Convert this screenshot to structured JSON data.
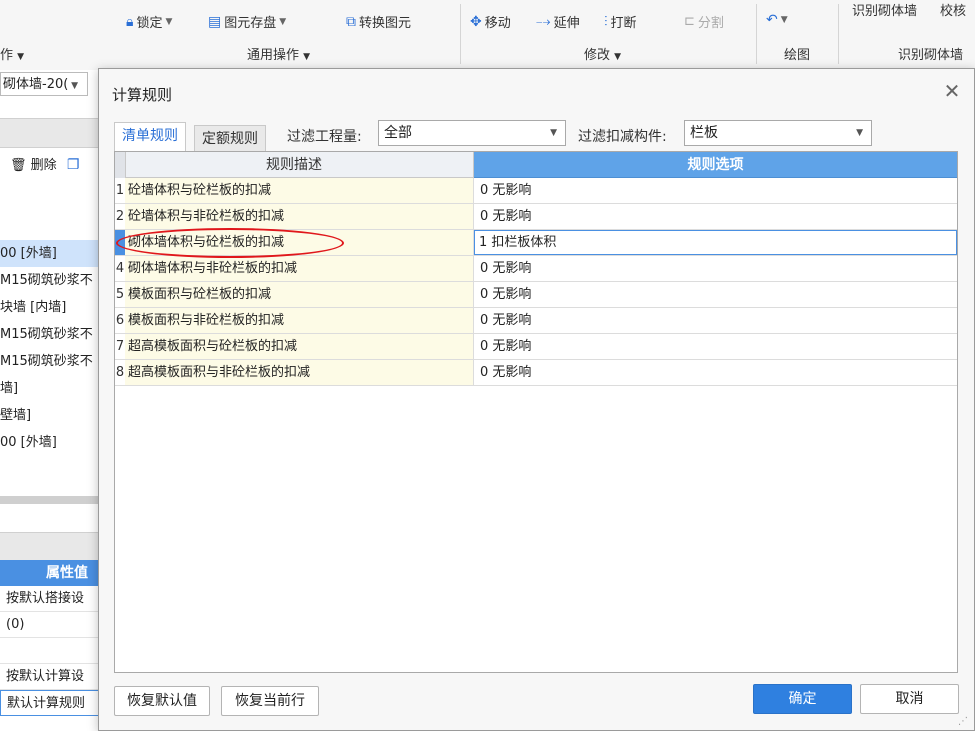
{
  "ribbon": {
    "lock": "锁定",
    "store_element": "图元存盘",
    "convert_element": "转换图元",
    "general_ops": "通用操作",
    "move": "移动",
    "extend": "延伸",
    "break": "打断",
    "split": "分割",
    "modify": "修改",
    "draw": "绘图",
    "identify_wall": "识别砌体墙",
    "check": "校核",
    "identify_group": "识别砌体墙",
    "ops_truncated": "作"
  },
  "left_panel": {
    "combo_value": "砌体墙-20(",
    "delete": "删除",
    "list": [
      {
        "text": "00 [外墙]",
        "selected": true
      },
      {
        "text": "M15砌筑砂浆不",
        "selected": false
      },
      {
        "text": "块墙 [内墙]",
        "selected": false
      },
      {
        "text": "M15砌筑砂浆不",
        "selected": false
      },
      {
        "text": "M15砌筑砂浆不",
        "selected": false
      },
      {
        "text": "墙]",
        "selected": false
      },
      {
        "text": "壁墙]",
        "selected": false
      },
      {
        "text": "00 [外墙]",
        "selected": false
      }
    ],
    "prop_header": "属性值",
    "props": [
      "按默认搭接设",
      "(0)",
      "",
      "按默认计算设",
      "默认计算规则"
    ]
  },
  "dialog": {
    "title": "计算规则",
    "tabs": [
      "清单规则",
      "定额规则"
    ],
    "filter_qty_label": "过滤工程量:",
    "filter_qty_value": "全部",
    "filter_deduct_label": "过滤扣减构件:",
    "filter_deduct_value": "栏板",
    "columns": [
      "规则描述",
      "规则选项"
    ],
    "rows": [
      {
        "num": "1",
        "desc": "砼墙体积与砼栏板的扣减",
        "option": "0  无影响"
      },
      {
        "num": "2",
        "desc": "砼墙体积与非砼栏板的扣减",
        "option": "0  无影响"
      },
      {
        "num": "3",
        "desc": "砌体墙体积与砼栏板的扣减",
        "option": "1 扣栏板体积"
      },
      {
        "num": "4",
        "desc": "砌体墙体积与非砼栏板的扣减",
        "option": "0  无影响"
      },
      {
        "num": "5",
        "desc": "模板面积与砼栏板的扣减",
        "option": "0  无影响"
      },
      {
        "num": "6",
        "desc": "模板面积与非砼栏板的扣减",
        "option": "0  无影响"
      },
      {
        "num": "7",
        "desc": "超高模板面积与砼栏板的扣减",
        "option": "0  无影响"
      },
      {
        "num": "8",
        "desc": "超高模板面积与非砼栏板的扣减",
        "option": "0  无影响"
      }
    ],
    "buttons": {
      "restore_default": "恢复默认值",
      "restore_row": "恢复当前行",
      "ok": "确定",
      "cancel": "取消"
    }
  },
  "colors": {
    "accent": "#2f80e0",
    "header_blue": "#5fa3e8",
    "desc_bg": "#fdfbe6",
    "annotation_red": "#e0171b"
  }
}
